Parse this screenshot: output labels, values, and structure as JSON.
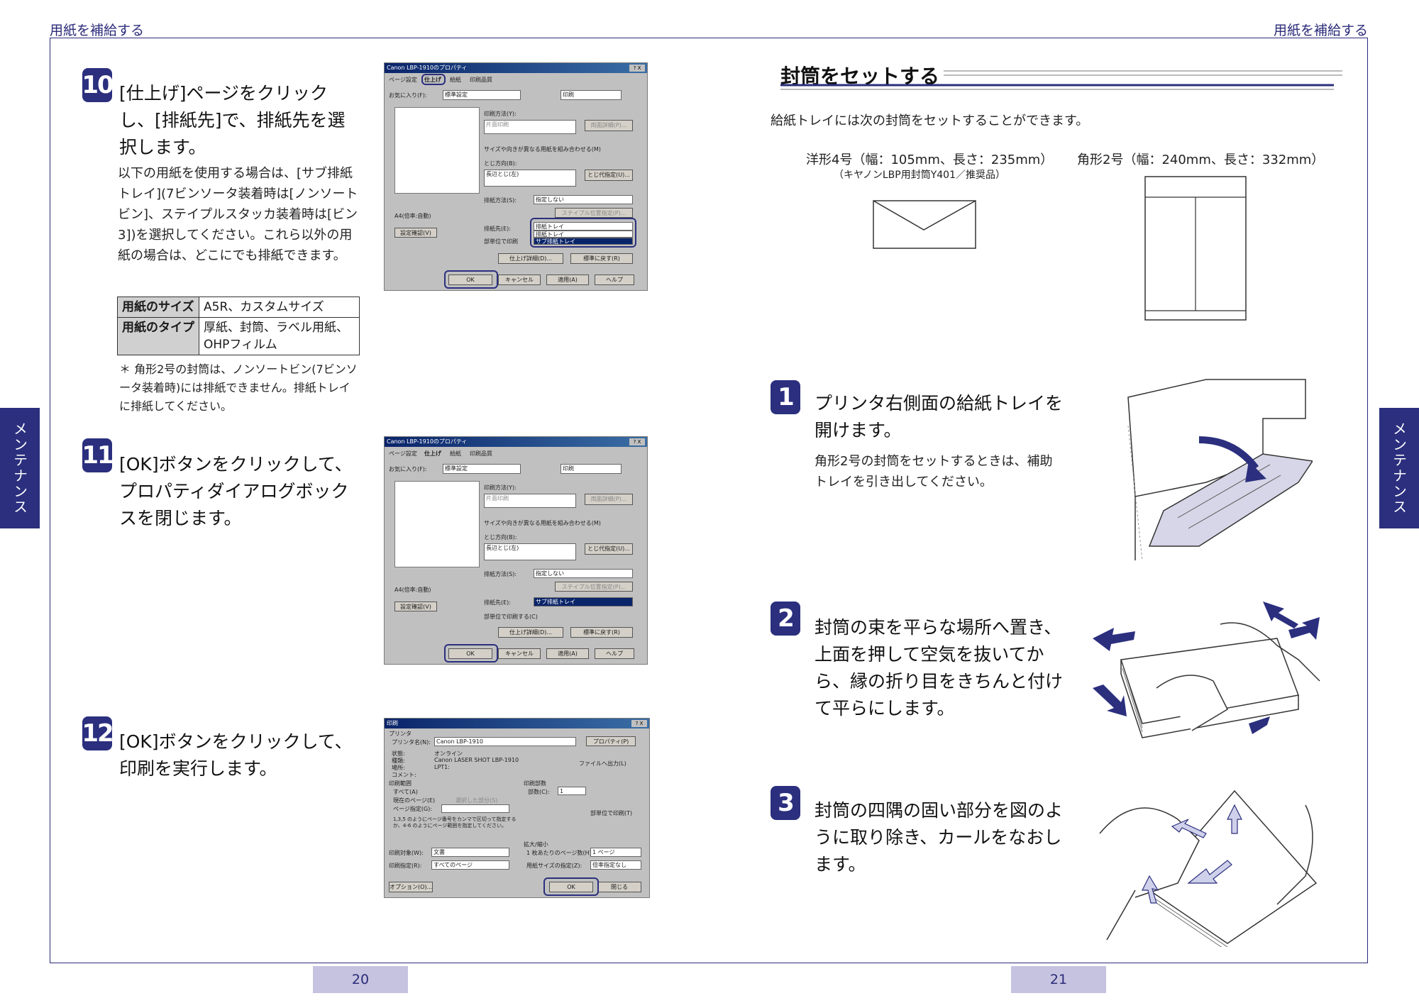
{
  "header": {
    "left": "用紙を補給する",
    "right": "用紙を補給する"
  },
  "side_tabs": {
    "left": "メンテナンス",
    "right": "メンテナンス"
  },
  "pages": {
    "left_number": "20",
    "right_number": "21"
  },
  "step10": {
    "number": "10",
    "title": "[仕上げ]ページをクリックし、[排紙先]で、排紙先を選択します。",
    "body": "以下の用紙を使用する場合は、[サブ排紙トレイ](7ビンソータ装着時は[ノンソートビン]、ステイプルスタッカ装着時は[ビン3])を選択してください。これら以外の用紙の場合は、どこにでも排紙できます。",
    "table": [
      {
        "key": "用紙のサイズ",
        "value": "A5R、カスタムサイズ"
      },
      {
        "key": "用紙のタイプ",
        "value": "厚紙、封筒、ラベル用紙、OHPフィルム"
      }
    ],
    "note": "＊ 角形2号の封筒は、ノンソートビン(7ビンソータ装着時)には排紙できません。排紙トレイに排紙してください。"
  },
  "step11": {
    "number": "11",
    "title": "[OK]ボタンをクリックして、プロパティダイアログボックスを閉じます。"
  },
  "step12": {
    "number": "12",
    "title": "[OK]ボタンをクリックして、印刷を実行します。"
  },
  "dialog_props": {
    "title": "Canon LBP-1910のプロパティ",
    "help_close": "? X",
    "tabs": [
      "ページ設定",
      "仕上げ",
      "給紙",
      "印刷品質"
    ],
    "favorites_label": "お気に入り(F):",
    "favorites_value": "標準設定",
    "output_value": "印刷",
    "print_method_label": "印刷方法(Y):",
    "print_method_value": "片面印刷",
    "print_method_btn": "両面詳細(P)...",
    "mixed_size_check": "サイズや向きが異なる用紙を組み合わせる(M)",
    "binding_label": "とじ方向(B):",
    "binding_value": "長辺とじ(左)",
    "binding_btn": "とじ代指定(U)...",
    "output_method_label": "排紙方法(S):",
    "output_method_value": "指定しない",
    "staple_btn": "ステイプル位置指定(P)...",
    "output_dest_label": "排紙先(E):",
    "dest_options": [
      "排紙トレイ",
      "排紙トレイ",
      "サブ排紙トレイ"
    ],
    "dest_selected": "サブ排紙トレイ",
    "collate_check": "部単位で印刷する(C)",
    "collate_check_cut": "部単位で印刷",
    "paper_caption": "A4(倍率:自動)",
    "confirm_btn": "設定確認(V)",
    "finish_detail_btn": "仕上げ詳細(D)...",
    "restore_btn": "標準に戻す(R)",
    "ok": "OK",
    "cancel": "キャンセル",
    "apply": "適用(A)",
    "help": "ヘルプ"
  },
  "dialog_print": {
    "title": "印刷",
    "help_close": "? X",
    "printer_group": "プリンタ",
    "printer_name_label": "プリンタ名(N):",
    "printer_name_value": "Canon LBP-1910",
    "properties_btn": "プロパティ(P)",
    "status_label": "状態:",
    "status_value": "オンライン",
    "type_label": "種類:",
    "type_value": "Canon LASER SHOT LBP-1910",
    "where_label": "場所:",
    "where_value": "LPT1:",
    "comment_label": "コメント:",
    "to_file": "ファイルへ出力(L)",
    "range_group": "印刷範囲",
    "range_all": "すべて(A)",
    "range_current": "現在のページ(E)",
    "range_selection": "選択した部分(S)",
    "range_pages": "ページ指定(G):",
    "range_hint": "1,3,5 のようにページ番号をカンマで区切って指定するか、4-6 のようにページ範囲を指定してください。",
    "copies_group": "印刷部数",
    "copies_label": "部数(C):",
    "copies_value": "1",
    "collate": "部単位で印刷(T)",
    "print_what_label": "印刷対象(W):",
    "print_what_value": "文書",
    "print_pages_label": "印刷指定(R):",
    "print_pages_value": "すべてのページ",
    "zoom_group": "拡大/縮小",
    "per_sheet_label": "1 枚あたりのページ数(H):",
    "per_sheet_value": "1 ページ",
    "scale_label": "用紙サイズの指定(Z):",
    "scale_value": "倍率指定なし",
    "options_btn": "オプション(O)...",
    "ok": "OK",
    "close": "閉じる"
  },
  "right_page": {
    "section_title": "封筒をセットする",
    "intro": "給紙トレイには次の封筒をセットすることができます。",
    "envelope1": {
      "caption": "洋形4号（幅：105mm、長さ：235mm）",
      "sub": "（キヤノンLBP用封筒Y401／推奨品）"
    },
    "envelope2": {
      "caption": "角形2号（幅：240mm、長さ：332mm）"
    },
    "step1": {
      "number": "1",
      "title": "プリンタ右側面の給紙トレイを開けます。",
      "body": "角形2号の封筒をセットするときは、補助トレイを引き出してください。"
    },
    "step2": {
      "number": "2",
      "title": "封筒の束を平らな場所へ置き、上面を押して空気を抜いてから、縁の折り目をきちんと付けて平らにします。"
    },
    "step3": {
      "number": "3",
      "title": "封筒の四隅の固い部分を図のように取り除き、カールをなおします。"
    }
  },
  "colors": {
    "brand_navy": "#2b2f7e",
    "page_number_bg": "#c5c3df"
  }
}
